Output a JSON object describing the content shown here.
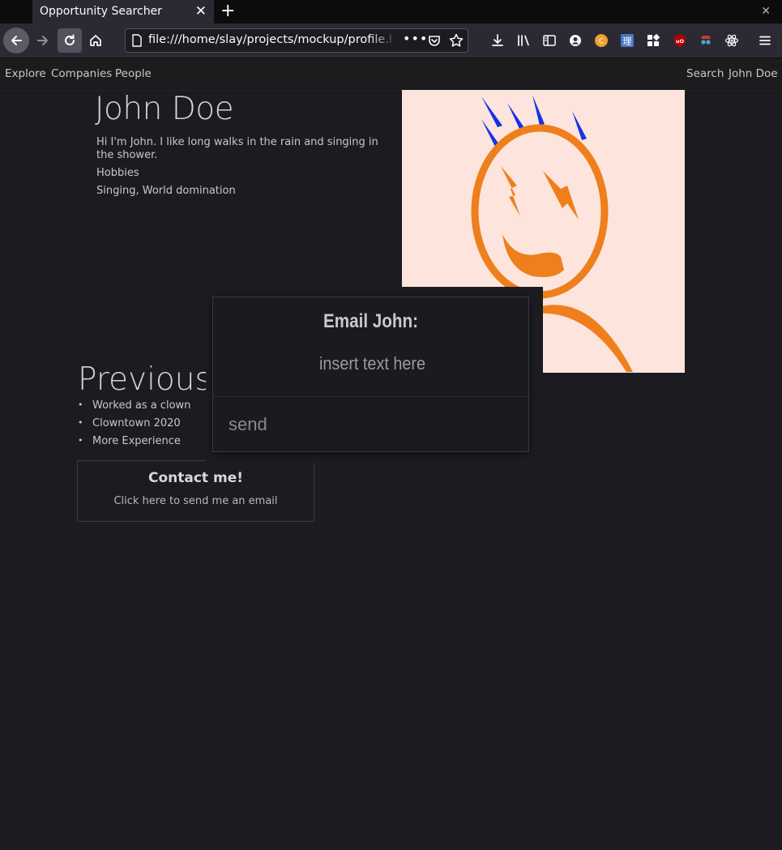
{
  "browser": {
    "tab_title": "Opportunity Searcher",
    "tab_close": "✕",
    "new_tab": "+",
    "window_close": "✕",
    "url": "file:///home/slay/projects/mockup/profile.html",
    "url_more": "•••"
  },
  "site_nav": {
    "left": [
      "Explore",
      "Companies",
      "People"
    ],
    "right": [
      "Search",
      "John Doe"
    ]
  },
  "profile": {
    "name": "John Doe",
    "bio": "Hi I'm John. I like long walks in the rain and singing in the shower.",
    "hobbies_label": "Hobbies",
    "hobbies": "Singing, World domination",
    "avatar_colors": {
      "background": "#fde4dc",
      "face": "#ee7f1c",
      "hair": "#1433e6"
    }
  },
  "experience": {
    "heading": "Previous Experience",
    "items": [
      "Worked as a clown",
      "Clowntown 2020",
      "More Experience"
    ]
  },
  "contact": {
    "title": "Contact me!",
    "subtitle": "Click here to send me an email"
  },
  "email_modal": {
    "title": "Email John:",
    "placeholder": "insert text here",
    "send_label": "send"
  }
}
